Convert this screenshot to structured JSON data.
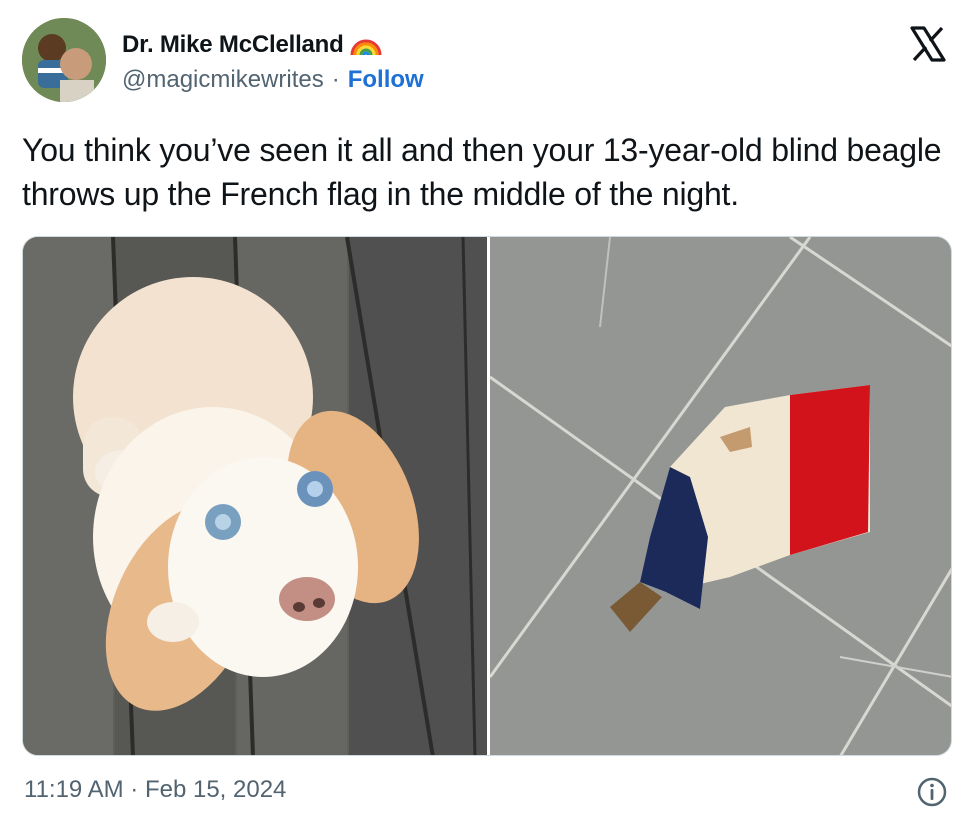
{
  "author": {
    "display_name": "Dr. Mike McClelland",
    "handle": "@magicmikewrites",
    "separator": "·",
    "follow_label": "Follow"
  },
  "tweet": {
    "text": "You think you’ve seen it all and then your 13-year-old blind beagle throws up the French flag in the middle of the night."
  },
  "media": {
    "images": [
      {
        "subject": "white beagle on wooden deck"
      },
      {
        "subject": "French flag on tiled floor"
      }
    ]
  },
  "footer": {
    "timestamp": "11:19 AM · Feb 15, 2024"
  },
  "icons": {
    "verified_emoji": "rainbow-icon",
    "brand": "x-logo-icon",
    "info": "info-icon"
  },
  "colors": {
    "follow_link": "#1d70d6",
    "secondary_text": "#536471",
    "flag_blue": "#1c2a5a",
    "flag_red": "#d3131c"
  }
}
